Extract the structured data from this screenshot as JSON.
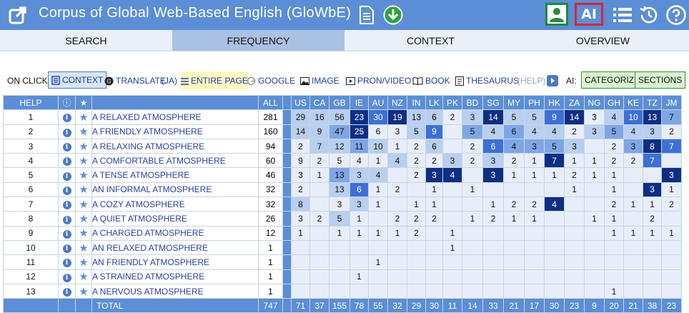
{
  "header": {
    "title": "Corpus of Global Web-Based English (GloWbE)",
    "ai_label": "AI"
  },
  "tabs": [
    "SEARCH",
    "FREQUENCY",
    "CONTEXT",
    "OVERVIEW"
  ],
  "active_tab": "FREQUENCY",
  "options": {
    "on_click_label": "ON CLICK:",
    "context": "CONTEXT",
    "translate": "TRANSLATE",
    "translate_lang": "(JA)",
    "entire_page": "ENTIRE PAGE",
    "google": "GOOGLE",
    "image": "IMAGE",
    "pron_video": "PRON/VIDEO",
    "book": "BOOK",
    "thesaurus": "THESAURUS",
    "help": "(HELP)",
    "ai_label": "AI:",
    "categorize": "CATEGORIZE",
    "sections": "SECTIONS"
  },
  "table": {
    "headers": {
      "help": "HELP",
      "info": "ⓘ",
      "star": "★",
      "all": "ALL"
    },
    "regions": [
      "US",
      "CA",
      "GB",
      "IE",
      "AU",
      "NZ",
      "IN",
      "LK",
      "PK",
      "BD",
      "SG",
      "MY",
      "PH",
      "HK",
      "ZA",
      "NG",
      "GH",
      "KE",
      "TZ",
      "JM"
    ],
    "rows": [
      {
        "n": "1",
        "phrase": "A RELAXED ATMOSPHERE",
        "all": "281",
        "cells": [
          "29",
          "16",
          "56",
          "23",
          "30",
          "19",
          "13",
          "6",
          "2",
          "3",
          "14",
          "5",
          "5",
          "9",
          "14",
          "3",
          "4",
          "10",
          "13",
          "7"
        ],
        "shades": [
          1,
          1,
          1,
          4,
          3,
          4,
          1,
          1,
          0,
          1,
          4,
          1,
          1,
          3,
          4,
          0,
          1,
          3,
          4,
          2
        ]
      },
      {
        "n": "2",
        "phrase": "A FRIENDLY ATMOSPHERE",
        "all": "160",
        "cells": [
          "14",
          "9",
          "47",
          "25",
          "6",
          "3",
          "5",
          "9",
          "",
          "5",
          "4",
          "6",
          "4",
          "4",
          "2",
          "3",
          "5",
          "4",
          "3",
          "2"
        ],
        "shades": [
          1,
          1,
          2,
          4,
          0,
          0,
          1,
          3,
          0,
          2,
          1,
          2,
          1,
          1,
          0,
          1,
          2,
          1,
          1,
          0
        ]
      },
      {
        "n": "3",
        "phrase": "A RELAXING ATMOSPHERE",
        "all": "94",
        "cells": [
          "2",
          "7",
          "12",
          "11",
          "10",
          "1",
          "2",
          "6",
          "",
          "2",
          "6",
          "4",
          "3",
          "5",
          "3",
          "",
          "2",
          "3",
          "8",
          "7"
        ],
        "shades": [
          0,
          1,
          1,
          2,
          1,
          0,
          0,
          1,
          0,
          0,
          3,
          2,
          2,
          2,
          1,
          0,
          0,
          2,
          4,
          3
        ]
      },
      {
        "n": "4",
        "phrase": "A COMFORTABLE ATMOSPHERE",
        "all": "60",
        "cells": [
          "9",
          "2",
          "5",
          "4",
          "1",
          "4",
          "2",
          "2",
          "3",
          "2",
          "3",
          "2",
          "1",
          "7",
          "1",
          "1",
          "2",
          "2",
          "7",
          ""
        ],
        "shades": [
          0,
          0,
          0,
          0,
          0,
          1,
          0,
          0,
          1,
          0,
          1,
          0,
          0,
          4,
          0,
          0,
          0,
          0,
          3,
          0
        ]
      },
      {
        "n": "5",
        "phrase": "A TENSE ATMOSPHERE",
        "all": "46",
        "cells": [
          "3",
          "1",
          "13",
          "3",
          "4",
          "",
          "2",
          "3",
          "4",
          "",
          "3",
          "1",
          "1",
          "1",
          "2",
          "1",
          "1",
          "",
          "",
          "3"
        ],
        "shades": [
          0,
          0,
          2,
          1,
          1,
          0,
          0,
          4,
          4,
          0,
          4,
          0,
          0,
          0,
          0,
          0,
          0,
          0,
          0,
          4
        ]
      },
      {
        "n": "6",
        "phrase": "AN INFORMAL ATMOSPHERE",
        "all": "32",
        "cells": [
          "2",
          "",
          "13",
          "6",
          "1",
          "2",
          "",
          "1",
          "",
          "1",
          "",
          "",
          "",
          "",
          "1",
          "",
          "1",
          "",
          "3",
          "1"
        ],
        "shades": [
          0,
          0,
          1,
          3,
          0,
          0,
          0,
          0,
          0,
          0,
          0,
          0,
          0,
          0,
          0,
          0,
          0,
          0,
          4,
          0
        ]
      },
      {
        "n": "7",
        "phrase": "A COZY ATMOSPHERE",
        "all": "32",
        "cells": [
          "8",
          "",
          "3",
          "3",
          "1",
          "",
          "1",
          "1",
          "",
          "",
          "1",
          "2",
          "2",
          "4",
          "",
          "",
          "2",
          "1",
          "1",
          "2"
        ],
        "shades": [
          1,
          0,
          0,
          1,
          0,
          0,
          0,
          0,
          0,
          0,
          0,
          0,
          0,
          4,
          0,
          0,
          0,
          0,
          0,
          0
        ]
      },
      {
        "n": "8",
        "phrase": "A QUIET ATMOSPHERE",
        "all": "26",
        "cells": [
          "3",
          "2",
          "5",
          "1",
          "",
          "2",
          "2",
          "2",
          "",
          "1",
          "2",
          "1",
          "1",
          "",
          "",
          "1",
          "1",
          "",
          "2",
          ""
        ],
        "shades": [
          0,
          0,
          1,
          0,
          0,
          0,
          0,
          0,
          0,
          0,
          0,
          0,
          0,
          0,
          0,
          0,
          0,
          0,
          0,
          0
        ]
      },
      {
        "n": "9",
        "phrase": "A CHARGED ATMOSPHERE",
        "all": "12",
        "cells": [
          "1",
          "",
          "1",
          "1",
          "1",
          "1",
          "2",
          "",
          "1",
          "",
          "",
          "",
          "",
          "",
          "",
          "",
          "1",
          "1",
          "1",
          "1"
        ],
        "shades": [
          0,
          0,
          0,
          0,
          0,
          0,
          0,
          0,
          0,
          0,
          0,
          0,
          0,
          0,
          0,
          0,
          0,
          0,
          0,
          0
        ]
      },
      {
        "n": "10",
        "phrase": "AN RELAXED ATMOSPHERE",
        "all": "1",
        "cells": [
          "",
          "",
          "",
          "",
          "",
          "",
          "",
          "",
          "1",
          "",
          "",
          "",
          "",
          "",
          "",
          "",
          "",
          "",
          "",
          ""
        ],
        "shades": [
          0,
          0,
          0,
          0,
          0,
          0,
          0,
          0,
          0,
          0,
          0,
          0,
          0,
          0,
          0,
          0,
          0,
          0,
          0,
          0
        ]
      },
      {
        "n": "11",
        "phrase": "AN FRIENDLY ATMOSPHERE",
        "all": "1",
        "cells": [
          "",
          "",
          "",
          "",
          "1",
          "",
          "",
          "",
          "",
          "",
          "",
          "",
          "",
          "",
          "",
          "",
          "",
          "",
          "",
          ""
        ],
        "shades": [
          0,
          0,
          0,
          0,
          0,
          0,
          0,
          0,
          0,
          0,
          0,
          0,
          0,
          0,
          0,
          0,
          0,
          0,
          0,
          0
        ]
      },
      {
        "n": "12",
        "phrase": "A STRAINED ATMOSPHERE",
        "all": "1",
        "cells": [
          "",
          "",
          "",
          "1",
          "",
          "",
          "",
          "",
          "",
          "",
          "",
          "",
          "",
          "",
          "",
          "",
          "",
          "",
          "",
          ""
        ],
        "shades": [
          0,
          0,
          0,
          0,
          0,
          0,
          0,
          0,
          0,
          0,
          0,
          0,
          0,
          0,
          0,
          0,
          0,
          0,
          0,
          0
        ]
      },
      {
        "n": "13",
        "phrase": "A NERVOUS ATMOSPHERE",
        "all": "1",
        "cells": [
          "",
          "",
          "",
          "",
          "",
          "",
          "",
          "",
          "",
          "",
          "",
          "",
          "",
          "",
          "",
          "",
          "1",
          "",
          "",
          ""
        ],
        "shades": [
          0,
          0,
          0,
          0,
          0,
          0,
          0,
          0,
          0,
          0,
          0,
          0,
          0,
          0,
          0,
          0,
          0,
          0,
          0,
          0
        ]
      }
    ],
    "total": {
      "label": "TOTAL",
      "all": "747",
      "cells": [
        "71",
        "37",
        "155",
        "78",
        "55",
        "32",
        "29",
        "30",
        "11",
        "14",
        "33",
        "21",
        "17",
        "30",
        "23",
        "9",
        "20",
        "21",
        "38",
        "23"
      ]
    }
  },
  "colors": {
    "header_bg": "#5b8ed6",
    "shade_0": "#e7eefa",
    "shade_1": "#b9cff0",
    "shade_2": "#7ea6e6",
    "shade_3": "#3d6fd6",
    "shade_4": "#0c2f84"
  }
}
